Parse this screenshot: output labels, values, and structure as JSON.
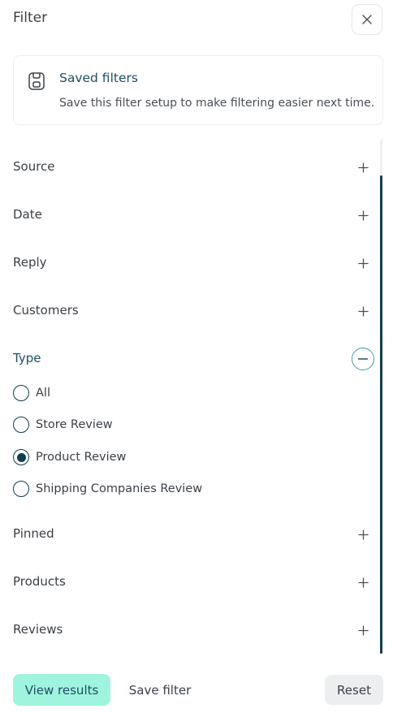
{
  "header": {
    "title": "Filter"
  },
  "saved_filters": {
    "title": "Saved filters",
    "description": "Save this filter setup to make filtering easier next time."
  },
  "sections": [
    {
      "label": "Source",
      "expanded": false
    },
    {
      "label": "Date",
      "expanded": false
    },
    {
      "label": "Reply",
      "expanded": false
    },
    {
      "label": "Customers",
      "expanded": false
    },
    {
      "label": "Type",
      "expanded": true
    },
    {
      "label": "Pinned",
      "expanded": false
    },
    {
      "label": "Products",
      "expanded": false
    },
    {
      "label": "Reviews",
      "expanded": false
    }
  ],
  "type_options": [
    {
      "label": "All",
      "checked": false
    },
    {
      "label": "Store Review",
      "checked": false
    },
    {
      "label": "Product Review",
      "checked": true
    },
    {
      "label": "Shipping Companies Review",
      "checked": false
    }
  ],
  "footer": {
    "view_label": "View results",
    "save_label": "Save filter",
    "reset_label": "Reset"
  },
  "colors": {
    "accent": "#9ff4dd",
    "primary_dark": "#123f4f",
    "link": "#1e4f63",
    "teal_outline": "#3fa2a0"
  },
  "icons": {
    "close": "close-icon",
    "saved": "bookmark-icon",
    "expand": "plus-icon",
    "collapse": "minus-icon"
  }
}
